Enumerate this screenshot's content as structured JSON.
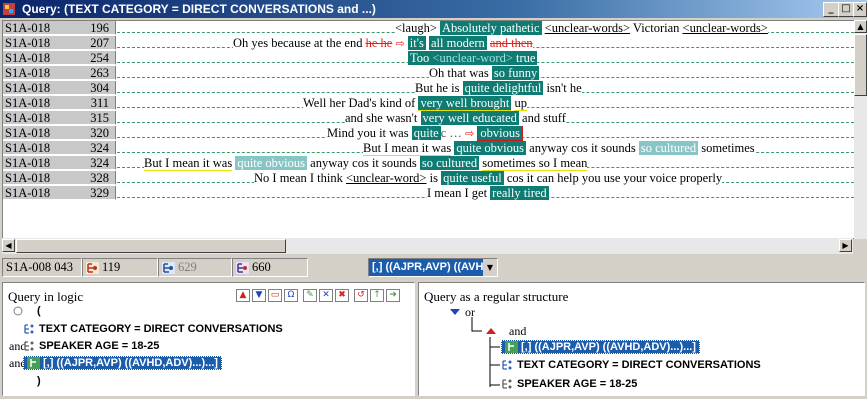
{
  "window": {
    "title": "Query: (TEXT CATEGORY = DIRECT CONVERSATIONS and ...)"
  },
  "colors": {
    "highlight": "#0e7c72",
    "highlight_light": "#88c6c6",
    "selection": "#1c5dab",
    "strike": "#e02020"
  },
  "concordance": {
    "rows": [
      {
        "file": "S1A-018",
        "num": "196"
      },
      {
        "file": "S1A-018",
        "num": "207"
      },
      {
        "file": "S1A-018",
        "num": "254"
      },
      {
        "file": "S1A-018",
        "num": "263"
      },
      {
        "file": "S1A-018",
        "num": "304"
      },
      {
        "file": "S1A-018",
        "num": "311"
      },
      {
        "file": "S1A-018",
        "num": "315"
      },
      {
        "file": "S1A-018",
        "num": "320"
      },
      {
        "file": "S1A-018",
        "num": "324"
      },
      {
        "file": "S1A-018",
        "num": "324"
      },
      {
        "file": "S1A-018",
        "num": "328"
      },
      {
        "file": "S1A-018",
        "num": "329"
      }
    ],
    "r0": {
      "left": "<laugh>",
      "kw": "Absolutely pathetic",
      "right_a": "<unclear-words>",
      "right_b": " Victorian ",
      "right_c": "<unclear-words>"
    },
    "r1": {
      "left": "Oh yes because at the end ",
      "strike1": "he he",
      "arrow": "⇨",
      "kw1": "it's",
      "kw2": "all modern",
      "strike2": "and then"
    },
    "r2": {
      "kw_a": "Too ",
      "kw_b": "<unclear-word>",
      "kw_c": " true"
    },
    "r3": {
      "left": "Oh that was",
      "kw": "so funny"
    },
    "r4": {
      "left": "But he is",
      "kw": "quite delightful",
      "right": "isn't he"
    },
    "r5": {
      "left": "Well her Dad's kind of",
      "kw": "very well brought",
      "right": "up"
    },
    "r6": {
      "left": "and she wasn't",
      "kw": "very well educated",
      "right": "and stuff"
    },
    "r7": {
      "left": "Mind you it was",
      "kw1": "quite",
      "mid": "c … ",
      "arrow": "⇨",
      "kw2": "obvious"
    },
    "r8": {
      "left": "But I mean it was",
      "kw": "quite obvious",
      "right_a": "anyway cos it sounds",
      "right_kw": "so cultured",
      "right_b": "sometimes"
    },
    "r9": {
      "left": "But I mean it was",
      "kw": "quite obvious",
      "right_a": "anyway cos it sounds",
      "right_kw": "so cultured",
      "right_b": "sometimes so I mean"
    },
    "r10": {
      "left": "No I mean I think ",
      "left_u": "<unclear-word>",
      "left_b": " is",
      "kw": "quite useful",
      "right": "cos it can help you use your voice properly"
    },
    "r11": {
      "left": "I mean I get",
      "kw": "really tired"
    }
  },
  "statusbar": {
    "location": "S1A-008  043",
    "count1": "119",
    "count2": "629",
    "count3": "660",
    "query": "[,] ((AJPR,AVP) ((AVHD,A"
  },
  "logic_panel": {
    "title": "Query in logic",
    "paren_open": "(",
    "line1": "TEXT CATEGORY = DIRECT CONVERSATIONS",
    "and1": "and",
    "line2": "SPEAKER AGE = 18-25",
    "and2": "and",
    "line3": "[,] ((AJPR,AVP) ((AVHD,ADV)...)...]",
    "paren_close": ")"
  },
  "structure_panel": {
    "title": "Query as a regular structure",
    "or_label": "or",
    "and_label": "and",
    "node1": "[,] ((AJPR,AVP) ((AVHD,ADV)...)...]",
    "node2": "TEXT CATEGORY = DIRECT CONVERSATIONS",
    "node3": "SPEAKER AGE = 18-25"
  }
}
